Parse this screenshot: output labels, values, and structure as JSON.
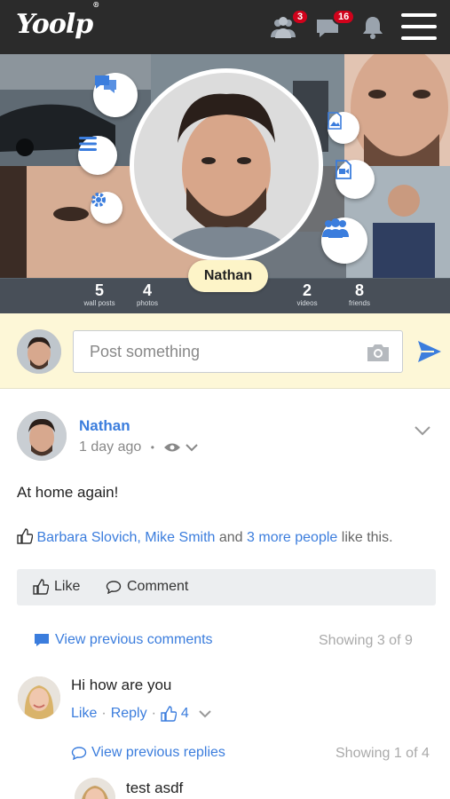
{
  "app": {
    "logo_text": "Yoolp",
    "logo_mark": "®",
    "notifications": {
      "friend_requests": "3",
      "messages": "16"
    }
  },
  "profile": {
    "name": "Nathan",
    "stats": [
      {
        "value": "5",
        "label": "wall posts"
      },
      {
        "value": "4",
        "label": "photos"
      },
      {
        "value": "2",
        "label": "videos"
      },
      {
        "value": "8",
        "label": "friends"
      }
    ]
  },
  "composer": {
    "placeholder": "Post something"
  },
  "post": {
    "author": "Nathan",
    "time": "1 day ago",
    "separator": "•",
    "text": "At home again!",
    "likes": {
      "names": "Barbara Slovich, Mike Smith",
      "connector": " and ",
      "more": "3 more people",
      "suffix": " like this."
    },
    "actions": {
      "like": "Like",
      "comment": "Comment"
    },
    "comments_link": "View previous comments",
    "comments_count": "Showing 3 of 9"
  },
  "comment": {
    "text": "Hi how are you",
    "like": "Like",
    "reply": "Reply",
    "like_count": "4",
    "replies_link": "View previous replies",
    "replies_count": "Showing 1 of 4",
    "reply_text": "test asdf"
  },
  "colors": {
    "topbar": "#2b2b2b",
    "accent": "#3b7ddd",
    "badge": "#d0021b",
    "composer_bg": "#fdf7d7",
    "name_pill": "#fdf4c8"
  },
  "icons": [
    "friends-icon",
    "messages-icon",
    "bell-icon",
    "hamburger-menu-icon",
    "chat-bubble-icon",
    "list-icon",
    "gear-icon",
    "image-icon",
    "video-icon",
    "group-icon",
    "camera-icon",
    "send-icon",
    "chevron-down-icon",
    "eye-icon",
    "thumbs-up-icon",
    "comment-icon"
  ]
}
